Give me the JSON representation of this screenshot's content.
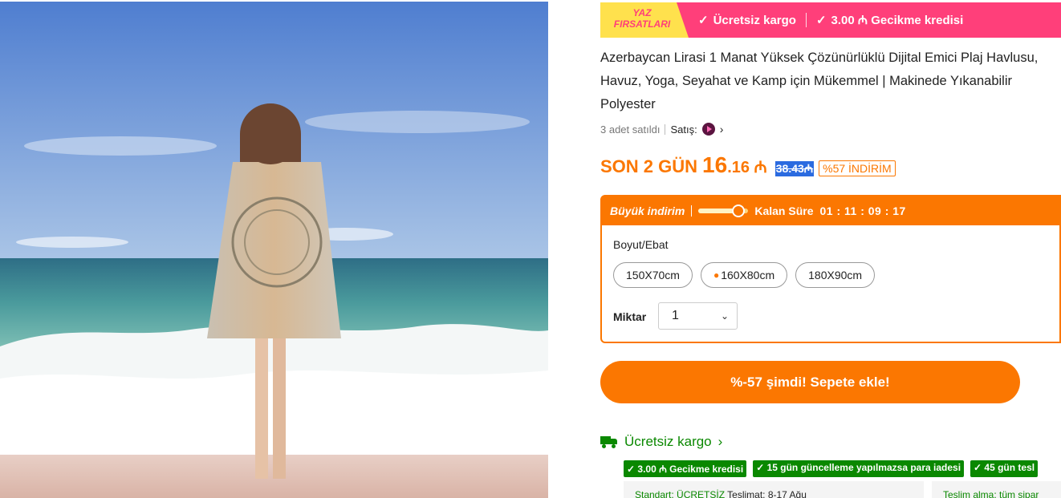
{
  "promo": {
    "badge_line1": "YAZ",
    "badge_line2": "FIRSATLARI",
    "item1": "Ücretsiz kargo",
    "item2": "3.00 ₼ Gecikme kredisi",
    "colors": {
      "bar": "#ff3f7a",
      "badge": "#ffe14d"
    }
  },
  "product": {
    "title": "Azerbaycan Lirasi 1 Manat Yüksek Çözünürlüklü Dijital Emici Plaj Havlusu, Havuz, Yoga, Seyahat ve Kamp için Mükemmel | Makinede Yıkanabilir Polyester",
    "sold": "3 adet satıldı",
    "seller_label": "Satış:",
    "photo_alt": "product-photo"
  },
  "price": {
    "prefix": "SON 2 GÜN",
    "int": "16",
    "dec": ".16 ₼",
    "original": "38.43₼",
    "discount": "%57 İNDİRİM",
    "accent": "#fb7701"
  },
  "deal": {
    "label": "Büyük indirim",
    "countdown_label": "Kalan Süre",
    "countdown": "01 : 11 : 09 : 17",
    "size_label": "Boyut/Ebat",
    "sizes": [
      "150X70cm",
      "160X80cm",
      "180X90cm"
    ],
    "qty_label": "Miktar",
    "qty_value": "1"
  },
  "cart": {
    "label": "%-57 şimdi! Sepete ekle!"
  },
  "shipping": {
    "title": "Ücretsiz kargo",
    "tags": [
      "3.00 ₼ Gecikme kredisi",
      "15 gün güncelleme yapılmazsa para iadesi",
      "45 gün tesl"
    ],
    "card1_green": "Standart: ÜCRETSİZ",
    "card1_dark": "Teslimat: 8-17 Ağu",
    "card2": "Teslim alma: tüm sipar",
    "color": "#0a8800"
  }
}
